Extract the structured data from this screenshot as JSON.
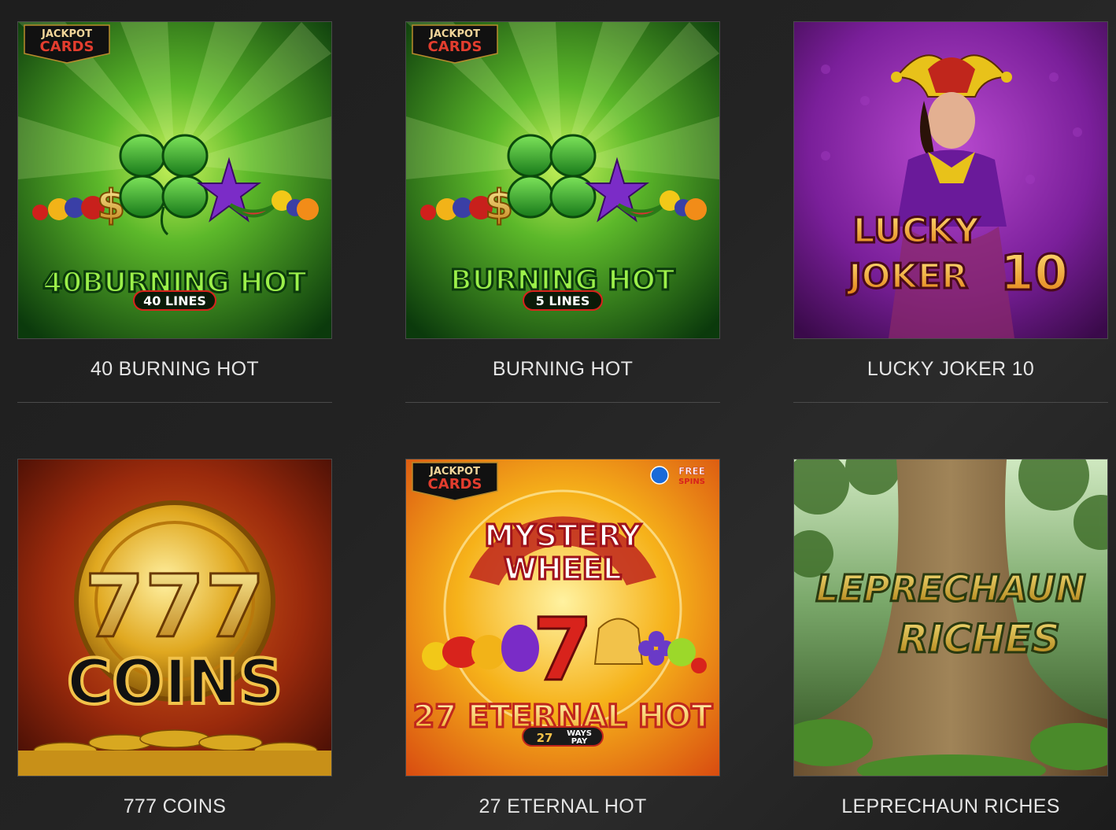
{
  "games": [
    {
      "title": "40 BURNING HOT",
      "art_title": "40BURNING HOT",
      "badge": "40 LINES",
      "corner_badge": [
        "JACKPOT",
        "CARDS"
      ]
    },
    {
      "title": "BURNING HOT",
      "art_title": "BURNING HOT",
      "badge": "5 LINES",
      "corner_badge": [
        "JACKPOT",
        "CARDS"
      ]
    },
    {
      "title": "LUCKY JOKER 10",
      "art_title": [
        "LUCKY",
        "JOKER",
        "10"
      ]
    },
    {
      "title": "777 COINS",
      "art_title": [
        "777",
        "COINS"
      ]
    },
    {
      "title": "27 ETERNAL HOT",
      "art_title": [
        "MYSTERY",
        "WHEEL",
        "27 ETERNAL HOT"
      ],
      "badge": [
        "27",
        "WAYS",
        "PAY"
      ],
      "corner_badge": [
        "JACKPOT",
        "CARDS"
      ],
      "free_spins": [
        "FREE",
        "SPINS"
      ]
    },
    {
      "title": "LEPRECHAUN RICHES",
      "art_title": [
        "LEPRECHAUN",
        "RICHES"
      ]
    }
  ],
  "colors": {
    "background": "#222222",
    "border": "#4a4a4a",
    "title_text": "#e4e4e4"
  }
}
